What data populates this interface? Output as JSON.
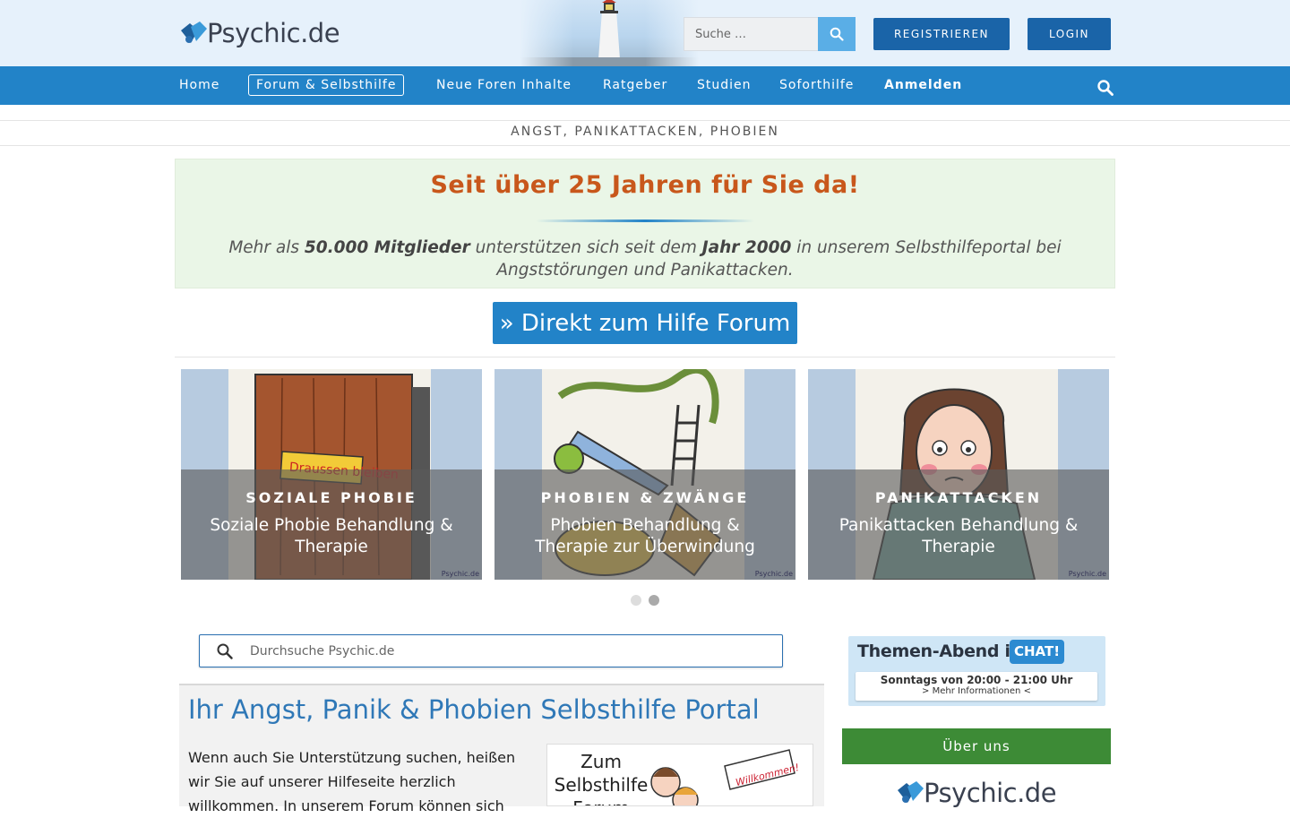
{
  "header": {
    "logo_text": "Psychic.de",
    "search_placeholder": "Suche …",
    "register_label": "REGISTRIEREN",
    "login_label": "LOGIN"
  },
  "nav": {
    "items": [
      {
        "label": "Home"
      },
      {
        "label": "Forum & Selbsthilfe"
      },
      {
        "label": "Neue Foren Inhalte"
      },
      {
        "label": "Ratgeber"
      },
      {
        "label": "Studien"
      },
      {
        "label": "Soforthilfe"
      },
      {
        "label": "Anmelden"
      }
    ],
    "active_index": 1
  },
  "subheader": {
    "title": "ANGST, PANIKATTACKEN, PHOBIEN"
  },
  "banner": {
    "title": "Seit über 25 Jahren für Sie da!",
    "text_1": "Mehr als ",
    "text_bold_1": "50.000 Mitglieder",
    "text_2": " unterstützen sich seit dem ",
    "text_bold_2": "Jahr 2000",
    "text_3": " in unserem Selbsthilfeportal bei Angststörungen und Panikattacken."
  },
  "cta": {
    "label": "» Direkt zum Hilfe Forum"
  },
  "cards": [
    {
      "category": "SOZIALE PHOBIE",
      "description": "Soziale Phobie Behandlung & Therapie",
      "art_text": "Draussen bleiben",
      "watermark": "Psychic.de"
    },
    {
      "category": "PHOBIEN & ZWÄNGE",
      "description": "Phobien Behandlung & Therapie zur Überwindung",
      "watermark": "Psychic.de"
    },
    {
      "category": "PANIKATTACKEN",
      "description": "Panikattacken Behandlung & Therapie",
      "watermark": "Psychic.de"
    }
  ],
  "carousel": {
    "pages": 2,
    "active": 1
  },
  "site_search": {
    "placeholder": "Durchsuche Psychic.de"
  },
  "content": {
    "title": "Ihr Angst, Panik & Phobien Selbsthilfe Portal",
    "text": "Wenn auch Sie Unterstützung suchen, heißen wir Sie auf unserer Hilfeseite herzlich willkommen. In unserem Forum können sich",
    "forum_image_text": "Zum Selbsthilfe Forum",
    "forum_image_sign": "Willkommen!"
  },
  "sidebar": {
    "chat_title": "Themen-Abend im",
    "chat_badge": "CHAT!",
    "chat_time": "Sonntags von 20:00 - 21:00 Uhr",
    "chat_more": "> Mehr Informationen <",
    "about_label": "Über uns",
    "logo_text": "Psychic.de"
  },
  "colors": {
    "nav_bg": "#2283c8",
    "button_dark": "#1a64a8",
    "banner_title": "#c8571b",
    "about_green": "#3d8b36"
  }
}
